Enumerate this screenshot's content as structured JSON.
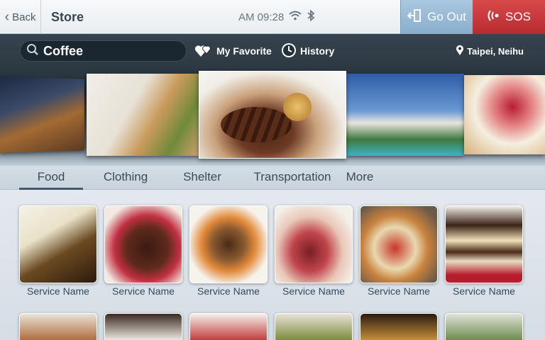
{
  "topbar": {
    "back_label": "Back",
    "title": "Store",
    "time": "AM 09:28",
    "go_out_label": "Go Out",
    "sos_label": "SOS"
  },
  "search": {
    "value": "Coffee",
    "placeholder": ""
  },
  "nav": {
    "favorite_label": "My Favorite",
    "history_label": "History",
    "location": "Taipei, Neihu"
  },
  "tabs": [
    {
      "label": "Food",
      "active": true
    },
    {
      "label": "Clothing",
      "active": false
    },
    {
      "label": "Shelter",
      "active": false
    },
    {
      "label": "Transportation",
      "active": false
    },
    {
      "label": "More",
      "active": false
    }
  ],
  "services": [
    {
      "label": "Service Name",
      "thumb": "iced-coffee"
    },
    {
      "label": "Service Name",
      "thumb": "chocolate-cake"
    },
    {
      "label": "Service Name",
      "thumb": "steak-lobster"
    },
    {
      "label": "Service Name",
      "thumb": "sliced-beef"
    },
    {
      "label": "Service Name",
      "thumb": "pizza"
    },
    {
      "label": "Service Name",
      "thumb": "layer-cake"
    }
  ],
  "colors": {
    "accent_blue": "#88aecd",
    "sos_red": "#c0393a",
    "band_dark": "#243039",
    "label_blue": "#2f4b60"
  }
}
